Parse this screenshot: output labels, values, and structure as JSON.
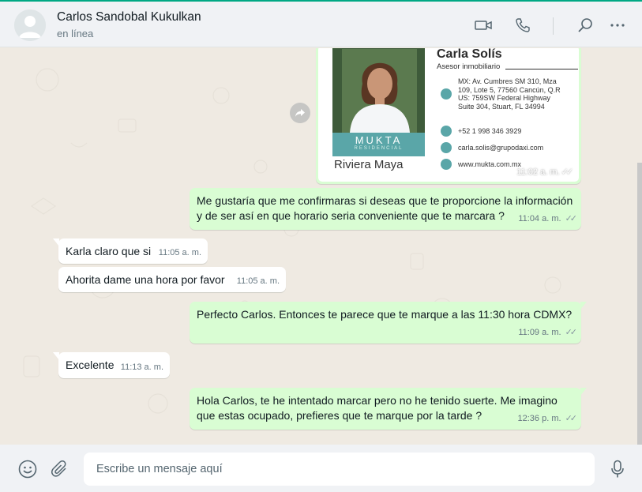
{
  "header": {
    "contact_name": "Carlos Sandobal Kukulkan",
    "status": "en línea",
    "icons": [
      "video-camera-icon",
      "phone-icon",
      "search-icon",
      "menu-dots-icon"
    ]
  },
  "colors": {
    "outgoing_bubble": "#d9fdd3",
    "incoming_bubble": "#ffffff",
    "chat_background": "#efeae2",
    "header_background": "#f0f2f5",
    "accent": "#00a884"
  },
  "image_message": {
    "card": {
      "name": "Carla Solís",
      "role": "Asesor inmobiliario",
      "brand": "MUKTA",
      "brand_sub": "RESIDENCIAL",
      "place": "Riviera Maya",
      "address": "MX: Av. Cumbres SM 310, Mza\n109, Lote 5, 77560 Cancún, Q.R\nUS: 759SW Federal Highway\nSuite 304, Stuart, FL 34994",
      "phone": "+52 1 998 346 3929",
      "email": "carla.solis@grupodaxi.com",
      "web": "www.mukta.com.mx"
    },
    "time": "11:02 a. m."
  },
  "messages": [
    {
      "direction": "out",
      "text": "Me gustaría que me confirmaras si deseas que te proporcione la información\ny de ser así en que horario seria conveniente que te marcara ?",
      "time": "11:04 a. m."
    },
    {
      "direction": "in",
      "text": "Karla claro que si",
      "time": "11:05 a. m."
    },
    {
      "direction": "in",
      "text": "Ahorita dame una hora por favor",
      "time": "11:05 a. m."
    },
    {
      "direction": "out",
      "text": "Perfecto Carlos. Entonces te parece que te marque a las  11:30 hora CDMX?",
      "time": "11:09 a. m."
    },
    {
      "direction": "in",
      "text": "Excelente",
      "time": "11:13 a. m."
    },
    {
      "direction": "out",
      "text": "Hola Carlos, te he intentado marcar pero no he tenido suerte. Me imagino\nque estas ocupado, prefieres que te marque por la tarde ?",
      "time": "12:36 p. m."
    }
  ],
  "composer": {
    "placeholder": "Escribe un mensaje aquí",
    "icons": [
      "emoji-icon",
      "paperclip-icon",
      "microphone-icon"
    ]
  }
}
